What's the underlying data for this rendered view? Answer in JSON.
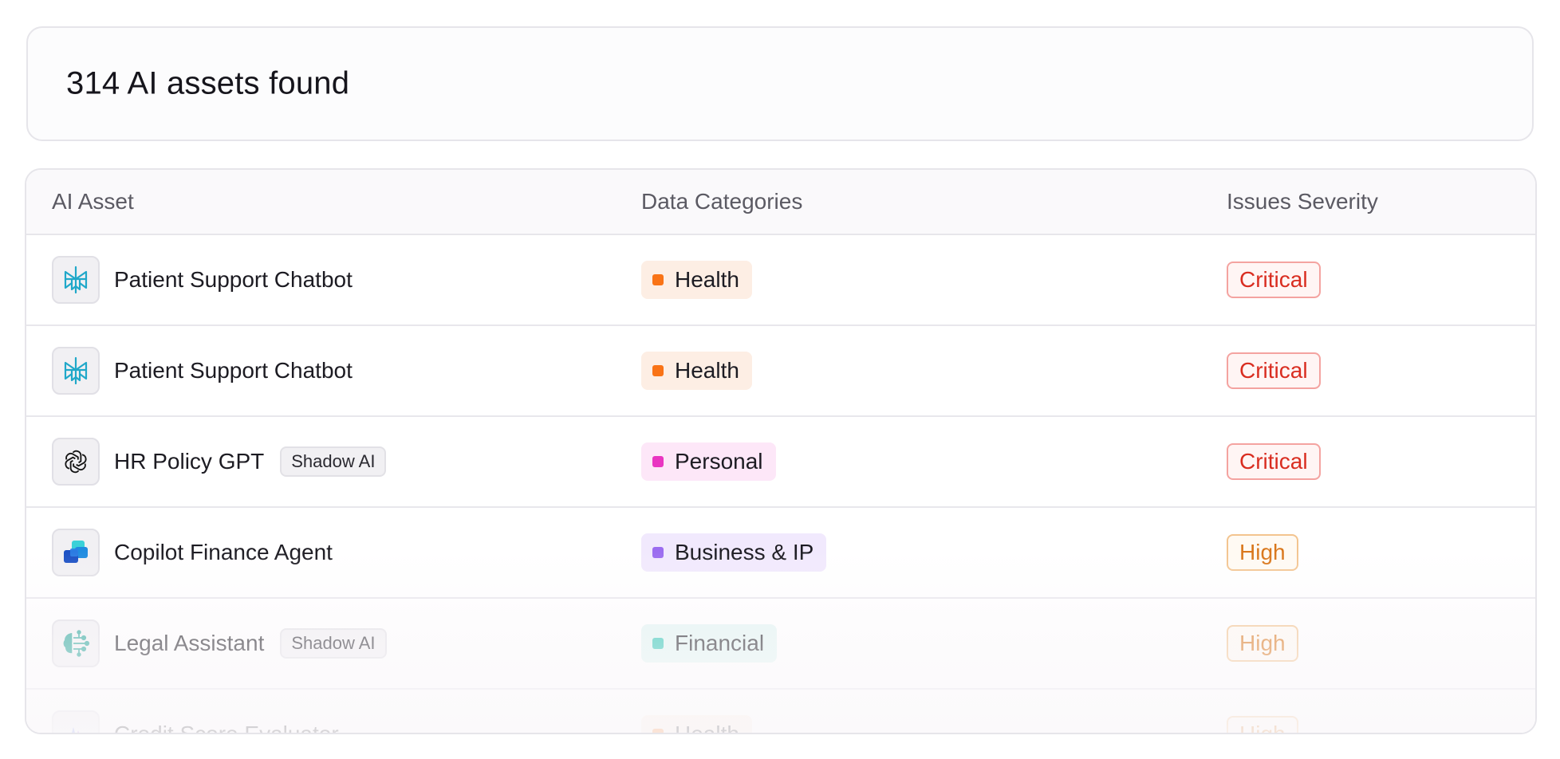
{
  "header": {
    "title": "314 AI assets found"
  },
  "table": {
    "columns": {
      "asset": "AI Asset",
      "categories": "Data Categories",
      "severity": "Issues Severity"
    },
    "rows": [
      {
        "name": "Patient Support Chatbot",
        "icon": "perplexity-logo-icon",
        "tag": "",
        "category": "Health",
        "category_color": "#f97316",
        "category_bg": "#fdeee4",
        "severity": "Critical",
        "severity_color": "#d92d20"
      },
      {
        "name": "Patient Support Chatbot",
        "icon": "perplexity-logo-icon",
        "tag": "",
        "category": "Health",
        "category_color": "#f97316",
        "category_bg": "#fdeee4",
        "severity": "Critical",
        "severity_color": "#d92d20"
      },
      {
        "name": "HR Policy GPT",
        "icon": "openai-logo-icon",
        "tag": "Shadow AI",
        "category": "Personal",
        "category_color": "#e935c1",
        "category_bg": "#fde7f8",
        "severity": "Critical",
        "severity_color": "#d92d20"
      },
      {
        "name": "Copilot Finance Agent",
        "icon": "copilot-logo-icon",
        "tag": "",
        "category": "Business & IP",
        "category_color": "#9b6cf0",
        "category_bg": "#f1e9fd",
        "severity": "High",
        "severity_color": "#d9761a"
      },
      {
        "name": "Legal Assistant",
        "icon": "ai-brain-icon",
        "tag": "Shadow AI",
        "category": "Financial",
        "category_color": "#2cc5b4",
        "category_bg": "#e2f6f3",
        "severity": "High",
        "severity_color": "#d9761a"
      },
      {
        "name": "Credit Score Evaluator",
        "icon": "evaluator-logo-icon",
        "tag": "",
        "category": "Health",
        "category_color": "#f97316",
        "category_bg": "#fdeee4",
        "severity": "High",
        "severity_color": "#d9761a"
      }
    ]
  }
}
